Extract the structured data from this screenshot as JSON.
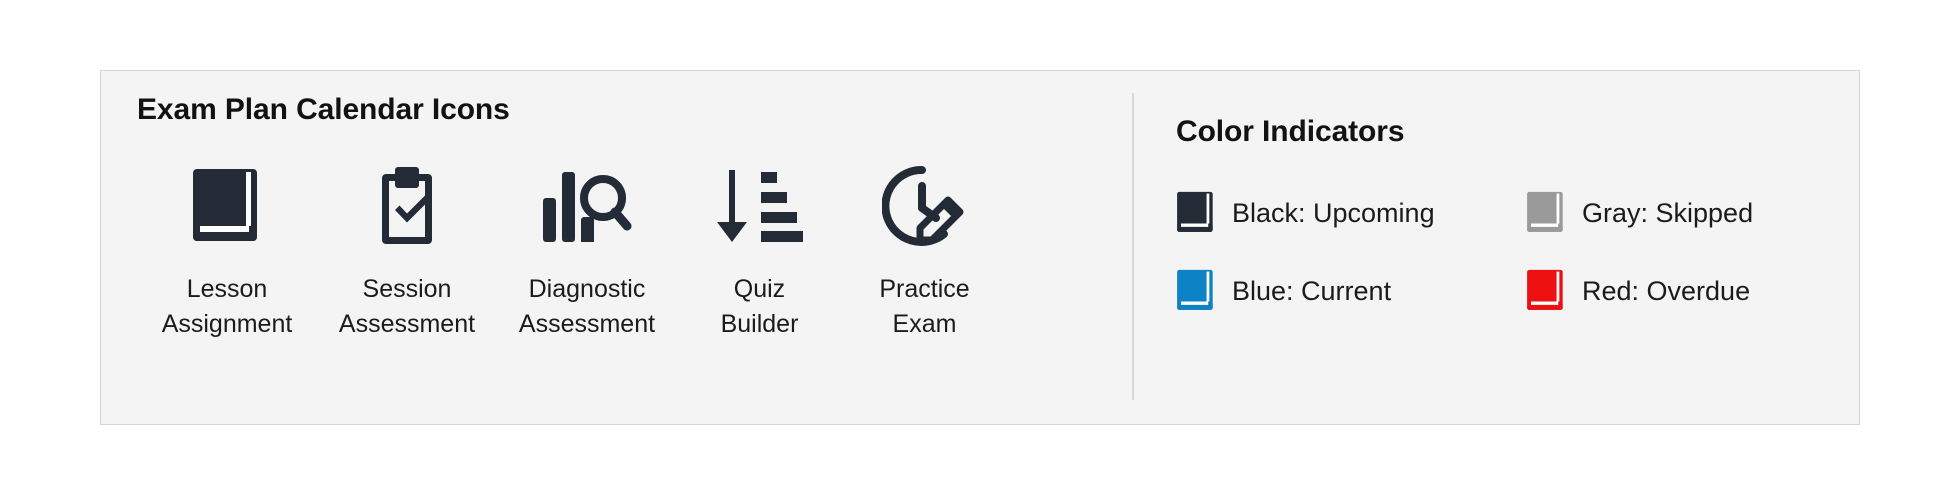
{
  "panel": {
    "background": "#f4f4f5",
    "border_color": "#d4d4d6",
    "divider_color": "#d8d8da"
  },
  "icon_legend": {
    "title": "Exam Plan Calendar Icons",
    "icon_color": "#222b36",
    "items": [
      {
        "icon": "book-icon",
        "label": "Lesson\nAssignment"
      },
      {
        "icon": "clipboard-check-icon",
        "label": "Session\nAssessment"
      },
      {
        "icon": "chart-search-icon",
        "label": "Diagnostic\nAssessment"
      },
      {
        "icon": "sort-amount-down-icon",
        "label": "Quiz\nBuilder"
      },
      {
        "icon": "clock-pencil-icon",
        "label": "Practice\nExam"
      }
    ]
  },
  "color_indicators": {
    "title": "Color Indicators",
    "items": [
      {
        "icon": "book-icon",
        "color": "#222b36",
        "label": "Black: Upcoming"
      },
      {
        "icon": "book-icon",
        "color": "#9a9a9a",
        "label": "Gray: Skipped"
      },
      {
        "icon": "book-icon",
        "color": "#0c83c4",
        "label": "Blue: Current"
      },
      {
        "icon": "book-icon",
        "color": "#ed1010",
        "label": "Red: Overdue"
      }
    ]
  }
}
